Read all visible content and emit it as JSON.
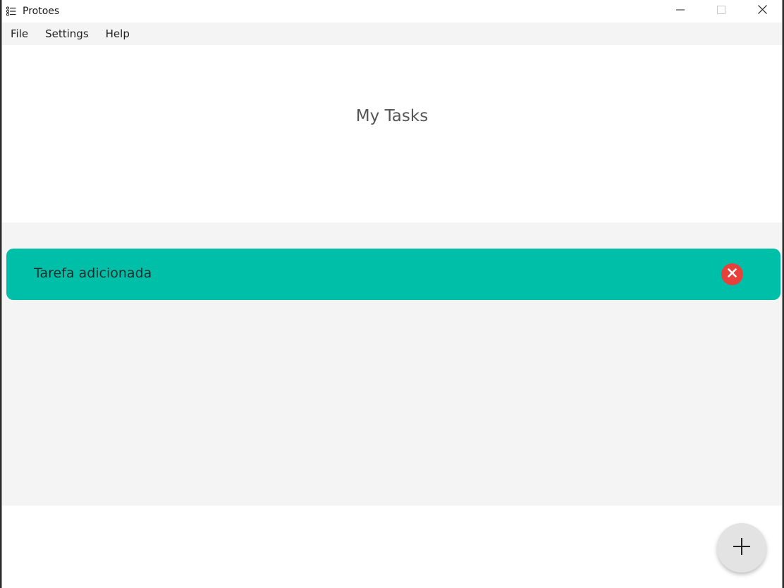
{
  "window": {
    "title": "Protoes",
    "icons": {
      "app": "list-icon",
      "minimize": "minimize-icon",
      "maximize": "maximize-icon",
      "close": "close-icon"
    }
  },
  "menu": {
    "items": [
      {
        "label": "File"
      },
      {
        "label": "Settings"
      },
      {
        "label": "Help"
      }
    ]
  },
  "header": {
    "title": "My Tasks"
  },
  "tasks": [
    {
      "label": "Tarefa adicionada",
      "delete_icon": "delete-x-icon"
    }
  ],
  "footer": {
    "add_icon": "plus-icon"
  },
  "colors": {
    "task_card": "#00bfa8",
    "delete_button": "#e8413c",
    "fab": "#e3e3e3",
    "list_background": "#f4f4f4"
  }
}
